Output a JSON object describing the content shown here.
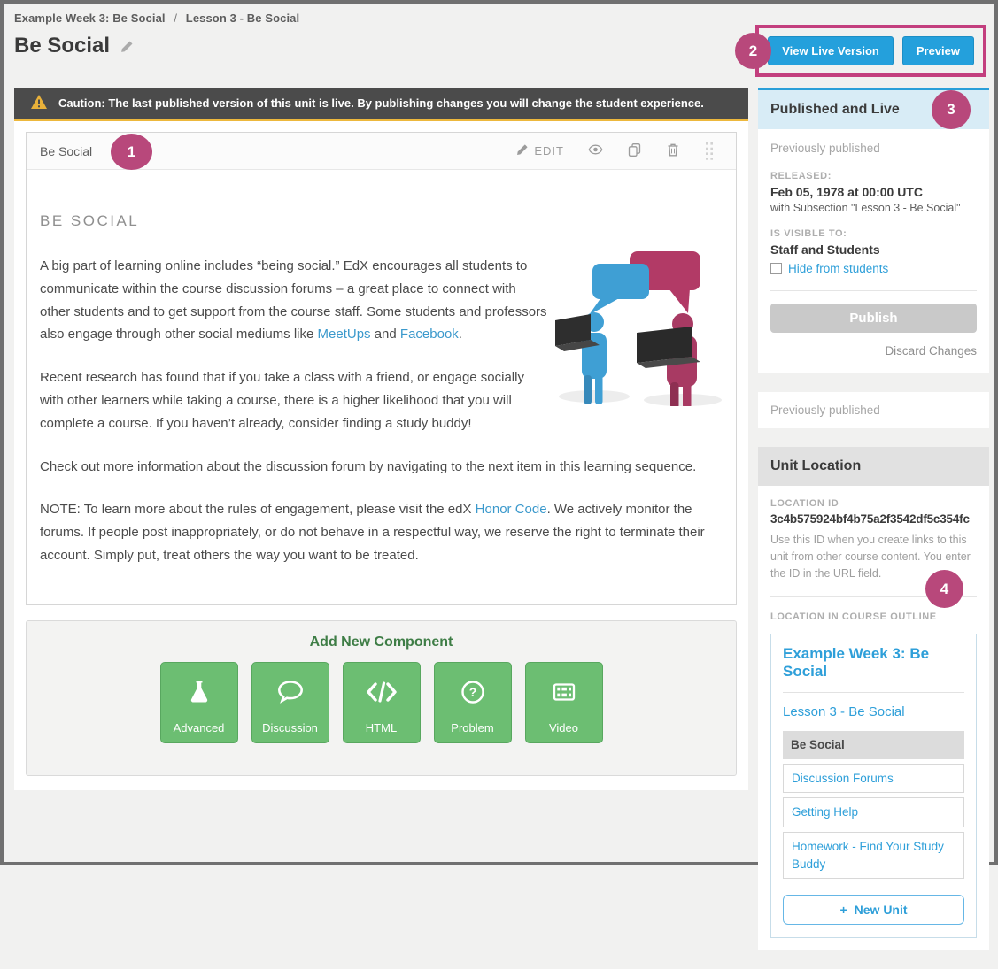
{
  "page": {
    "breadcrumb": {
      "part1": "Example Week 3: Be Social",
      "separator": "/",
      "part2": "Lesson 3 - Be Social"
    },
    "title": "Be Social"
  },
  "header_actions": {
    "view_live": "View Live Version",
    "preview": "Preview"
  },
  "banner": {
    "text": "Caution: The last published version of this unit is live. By publishing changes you will change the student experience."
  },
  "component": {
    "title": "Be Social",
    "toolbar": {
      "edit": "EDIT"
    },
    "content": {
      "heading": "BE SOCIAL",
      "p1": {
        "t1": "A big part of learning online includes “being social.” EdX encourages all students to communicate within the course discussion forums – a great place to connect with other students and to get support from the course staff. Some students and professors also engage through other social mediums like ",
        "l1": "MeetUps",
        "t2": " and ",
        "l2": "Facebook",
        "t3": "."
      },
      "p2": "Recent research has found that if you take a class with a friend, or engage socially with other learners while taking a course, there is a higher likelihood that you will complete a course. If you haven’t already, consider finding a study buddy!",
      "p3": "Check out more information about the discussion forum by navigating to the next item in this learning sequence.",
      "p4": {
        "t1": "NOTE: To learn more about the rules of engagement, please visit the edX ",
        "l1": "Honor Code",
        "t2": ". We actively monitor the forums. If people post inappropriately, or do not behave in a respectful way, we reserve the right to terminate their account. Simply put, treat others the way you want to be treated."
      }
    }
  },
  "add_component": {
    "title": "Add New Component",
    "buttons": [
      {
        "label": "Advanced",
        "icon": "flask-icon"
      },
      {
        "label": "Discussion",
        "icon": "speech-bubble-icon"
      },
      {
        "label": "HTML",
        "icon": "code-icon"
      },
      {
        "label": "Problem",
        "icon": "question-circle-icon"
      },
      {
        "label": "Video",
        "icon": "film-icon"
      }
    ]
  },
  "sidebar": {
    "publish_card": {
      "title": "Published and Live",
      "status": "Previously published",
      "released_label": "RELEASED:",
      "released_value": "Feb 05, 1978 at 00:00 UTC",
      "released_with": "with Subsection \"Lesson 3 - Be Social\"",
      "visible_label": "IS VISIBLE TO:",
      "visible_value": "Staff and Students",
      "hide_checkbox_label": "Hide from students",
      "publish_button": "Publish",
      "discard_link": "Discard Changes"
    },
    "history_card": {
      "status": "Previously published"
    },
    "location_card": {
      "title": "Unit Location",
      "location_id_label": "LOCATION ID",
      "location_id": "3c4b575924bf4b75a2f3542df5c354fc",
      "location_help": "Use this ID when you create links to this unit from other course content. You enter the ID in the URL field.",
      "outline_label": "LOCATION IN COURSE OUTLINE",
      "outline": {
        "section": "Example Week 3: Be Social",
        "subsection": "Lesson 3 - Be Social",
        "units": [
          {
            "label": "Be Social",
            "active": true
          },
          {
            "label": "Discussion Forums",
            "active": false
          },
          {
            "label": "Getting Help",
            "active": false
          },
          {
            "label": "Homework - Find Your Study Buddy",
            "active": false
          }
        ],
        "new_unit_plus": "+",
        "new_unit_button": "New Unit"
      }
    }
  },
  "annotations": {
    "n1": "1",
    "n2": "2",
    "n3": "3",
    "n4": "4"
  },
  "icons": [
    "pencil-icon",
    "warning-triangle-icon",
    "eye-icon",
    "copy-icon",
    "trash-icon",
    "drag-handle-icon",
    "flask-icon",
    "speech-bubble-icon",
    "code-icon",
    "question-circle-icon",
    "film-icon",
    "checkbox",
    "plus-icon"
  ],
  "colors": {
    "accent_blue": "#24a0dc",
    "link_blue": "#2e9fd9",
    "annotation_pink": "#b8487b",
    "banner_dark": "#4b4b4b",
    "banner_yellow": "#edb83d",
    "component_green": "#6cbe72",
    "add_title_green": "#3e7d46",
    "publish_disabled_gray": "#c9c9c9",
    "published_header_blue": "#d8ecf6"
  }
}
